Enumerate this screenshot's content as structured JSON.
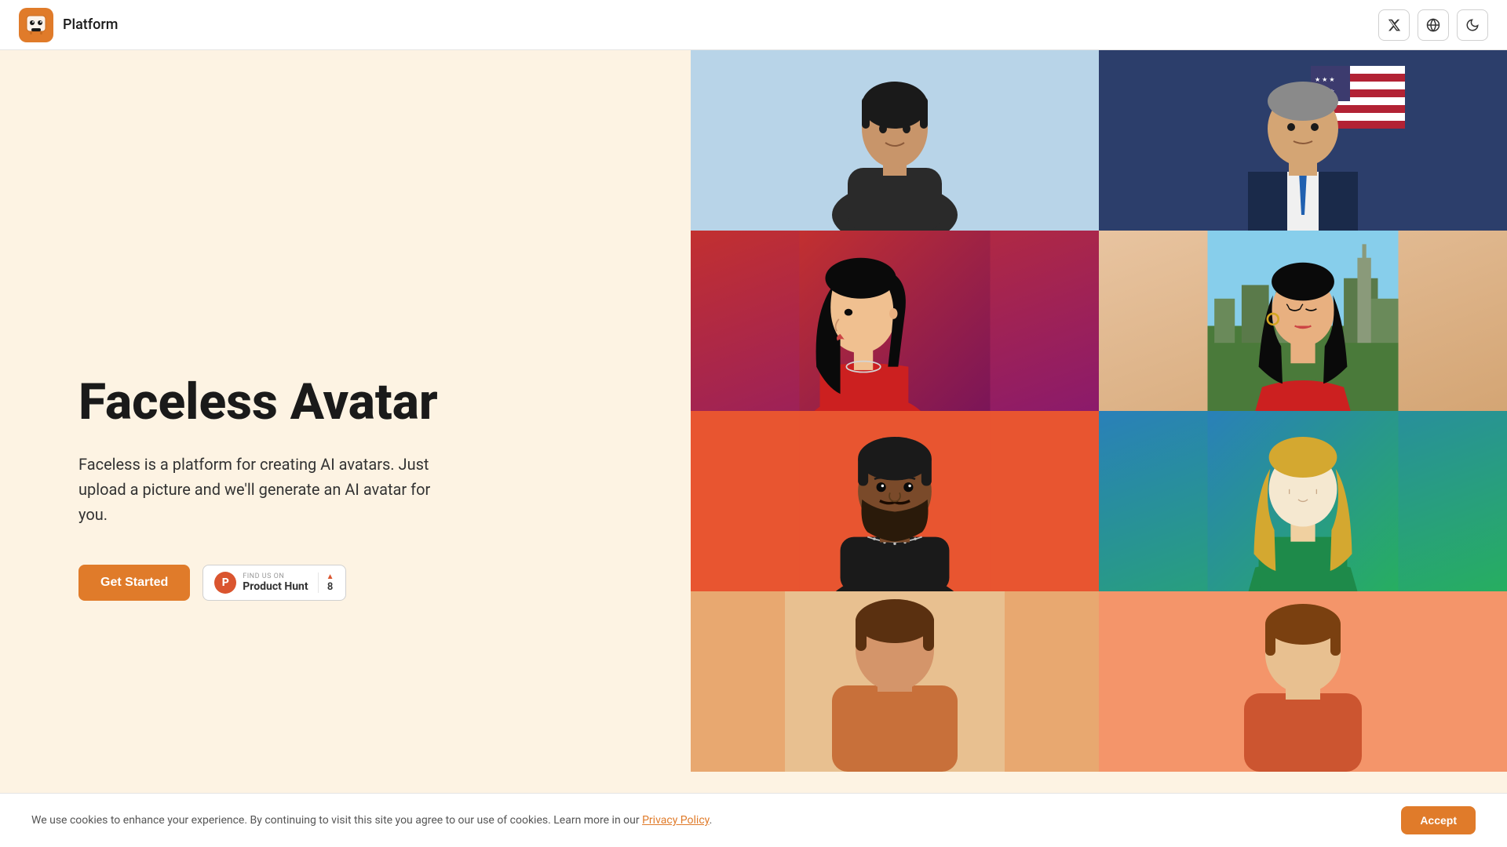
{
  "nav": {
    "title": "Platform",
    "twitter_label": "X",
    "globe_label": "Globe",
    "dark_label": "Dark mode"
  },
  "hero": {
    "title": "Faceless Avatar",
    "description": "Faceless is a platform for creating AI avatars. Just upload a picture and we'll generate an AI avatar for you.",
    "cta_label": "Get Started"
  },
  "product_hunt": {
    "find_us": "FIND US ON",
    "name": "Product Hunt",
    "count": "8",
    "logo_letter": "P"
  },
  "cookie": {
    "text": "We use cookies to enhance your experience. By continuing to visit this site you agree to our use of cookies. Learn more in our ",
    "link_text": "Privacy Policy",
    "accept_label": "Accept"
  },
  "cards": [
    {
      "id": 1,
      "alt": "Person in dark hoodie, light blue background"
    },
    {
      "id": 2,
      "alt": "Person in suit with American flag, dark blue background"
    },
    {
      "id": 3,
      "alt": "Woman with long black hair, red background"
    },
    {
      "id": 4,
      "alt": "Woman with long dark hair, city background"
    },
    {
      "id": 5,
      "alt": "Man with beard, orange-red background"
    },
    {
      "id": 6,
      "alt": "Woman with long blonde hair, teal-green background"
    },
    {
      "id": 7,
      "alt": "Person, warm background"
    },
    {
      "id": 8,
      "alt": "Person, peach background"
    }
  ]
}
